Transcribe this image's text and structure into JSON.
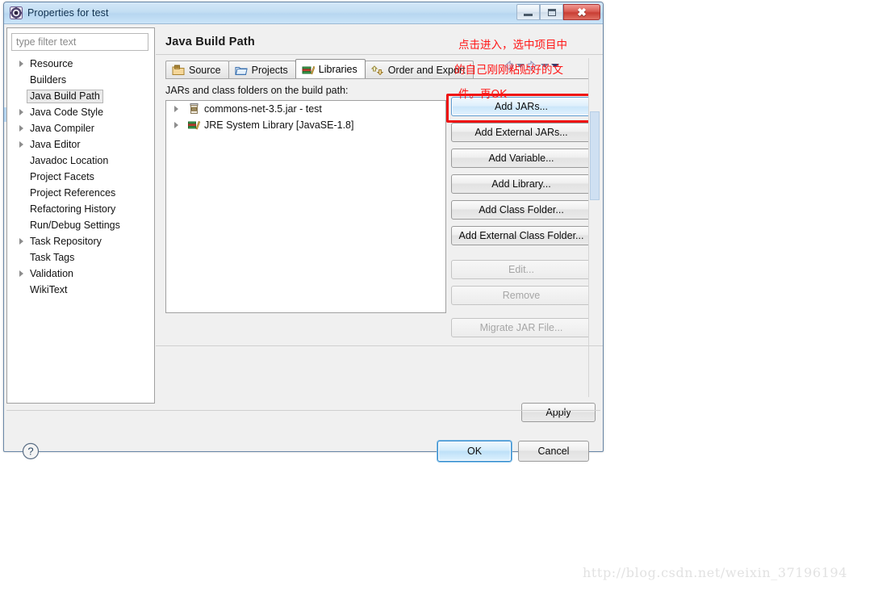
{
  "window": {
    "title": "Properties for test",
    "icon": "eclipse-properties-icon",
    "minimize_label": "–",
    "maximize_label": "□",
    "close_label": "✕"
  },
  "sidebar": {
    "filter_placeholder": "type filter text",
    "filter_value": "",
    "items": [
      {
        "label": "Resource",
        "expandable": true,
        "selected": false
      },
      {
        "label": "Builders",
        "expandable": false,
        "selected": false
      },
      {
        "label": "Java Build Path",
        "expandable": false,
        "selected": true
      },
      {
        "label": "Java Code Style",
        "expandable": true,
        "selected": false
      },
      {
        "label": "Java Compiler",
        "expandable": true,
        "selected": false
      },
      {
        "label": "Java Editor",
        "expandable": true,
        "selected": false
      },
      {
        "label": "Javadoc Location",
        "expandable": false,
        "selected": false
      },
      {
        "label": "Project Facets",
        "expandable": false,
        "selected": false
      },
      {
        "label": "Project References",
        "expandable": false,
        "selected": false
      },
      {
        "label": "Refactoring History",
        "expandable": false,
        "selected": false
      },
      {
        "label": "Run/Debug Settings",
        "expandable": false,
        "selected": false
      },
      {
        "label": "Task Repository",
        "expandable": true,
        "selected": false
      },
      {
        "label": "Task Tags",
        "expandable": false,
        "selected": false
      },
      {
        "label": "Validation",
        "expandable": true,
        "selected": false
      },
      {
        "label": "WikiText",
        "expandable": false,
        "selected": false
      }
    ]
  },
  "main": {
    "page_title": "Java Build Path",
    "tabs": [
      {
        "label": "Source",
        "icon": "source-folder-icon",
        "active": false
      },
      {
        "label": "Projects",
        "icon": "projects-folder-icon",
        "active": false
      },
      {
        "label": "Libraries",
        "icon": "libraries-books-icon",
        "active": true
      },
      {
        "label": "Order and Export",
        "icon": "order-export-arrows-icon",
        "active": false
      }
    ],
    "list_label": "JARs and class folders on the build path:",
    "jar_entries": [
      {
        "label": "commons-net-3.5.jar - test",
        "icon": "jar-file-icon"
      },
      {
        "label": "JRE System Library [JavaSE-1.8]",
        "icon": "jre-library-icon"
      }
    ],
    "buttons": [
      {
        "label": "Add JARs...",
        "state": "highlighted"
      },
      {
        "label": "Add External JARs...",
        "state": "enabled"
      },
      {
        "label": "Add Variable...",
        "state": "enabled"
      },
      {
        "label": "Add Library...",
        "state": "enabled"
      },
      {
        "label": "Add Class Folder...",
        "state": "enabled"
      },
      {
        "label": "Add External Class Folder...",
        "state": "enabled"
      },
      {
        "label": "Edit...",
        "state": "disabled"
      },
      {
        "label": "Remove",
        "state": "disabled"
      },
      {
        "label": "Migrate JAR File...",
        "state": "disabled"
      }
    ],
    "apply_label": "Apply"
  },
  "footer": {
    "help_label": "?",
    "ok_label": "OK",
    "cancel_label": "Cancel"
  },
  "annotations": {
    "line1": "点击进入，选中项目中",
    "line2": "的自己刚刚粘贴好的文",
    "line3": "件。再OK",
    "highlight_color": "#ff1616"
  },
  "watermark": {
    "text": "http://blog.csdn.net/weixin_37196194"
  }
}
